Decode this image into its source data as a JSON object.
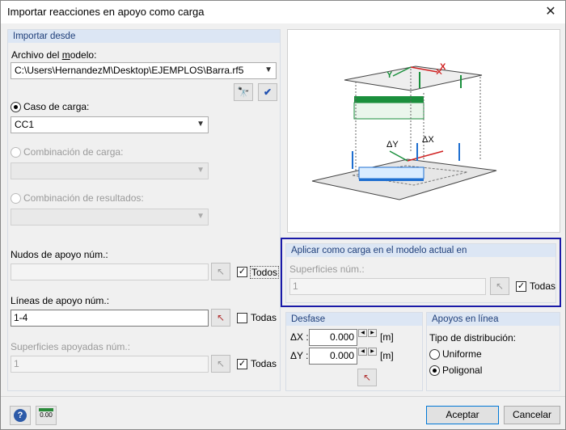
{
  "window": {
    "title": "Importar reacciones en apoyo como carga"
  },
  "import": {
    "header": "Importar desde",
    "file_label": "Archivo del modelo:",
    "file_path": "C:\\Users\\HernandezM\\Desktop\\EJEMPLOS\\Barra.rf5",
    "load_case_label": "Caso de carga:",
    "load_case_value": "CC1",
    "load_combo_label": "Combinación de carga:",
    "result_combo_label": "Combinación de resultados:",
    "nodes_label": "Nudos de apoyo núm.:",
    "nodes_value": "",
    "nodes_all": "Todos",
    "lines_label": "Líneas de apoyo núm.:",
    "lines_value": "1-4",
    "lines_all": "Todas",
    "surfaces_label": "Superficies apoyadas núm.:",
    "surfaces_value": "1",
    "surfaces_all": "Todas"
  },
  "apply": {
    "header": "Aplicar como carga en el modelo actual en",
    "surfaces_label": "Superficies núm.:",
    "surfaces_value": "1",
    "surfaces_all": "Todas"
  },
  "offset": {
    "header": "Desfase",
    "dx_label": "ΔX :",
    "dx_value": "0.000",
    "dy_label": "ΔY :",
    "dy_value": "0.000",
    "unit": "[m]"
  },
  "line_supports": {
    "header": "Apoyos en línea",
    "distribution_label": "Tipo de distribución:",
    "uniform": "Uniforme",
    "polygonal": "Poligonal"
  },
  "diagram": {
    "delta_y": "ΔY",
    "delta_x": "ΔX",
    "y": "Y",
    "x": "X"
  },
  "buttons": {
    "accept": "Aceptar",
    "cancel": "Cancelar",
    "units_icon_text": "0.00"
  },
  "colors": {
    "highlight_border": "#1a1aa8",
    "header_bg": "#dce6f4",
    "green": "#1a8f3c",
    "blue": "#1f6fd0",
    "red": "#d02020"
  }
}
